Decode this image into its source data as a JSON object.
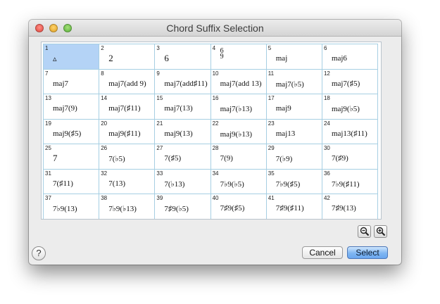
{
  "window": {
    "title": "Chord Suffix Selection"
  },
  "grid": {
    "cells": [
      {
        "n": "1",
        "label": "▵"
      },
      {
        "n": "2",
        "label": "2"
      },
      {
        "n": "3",
        "label": "6"
      },
      {
        "n": "4",
        "label_top": "6",
        "label_bottom": "9"
      },
      {
        "n": "5",
        "label": "maj"
      },
      {
        "n": "6",
        "label": "maj6"
      },
      {
        "n": "7",
        "label": "maj7"
      },
      {
        "n": "8",
        "label": "maj7(add 9)"
      },
      {
        "n": "9",
        "label": "maj7(add♯11)"
      },
      {
        "n": "10",
        "label": "maj7(add 13)"
      },
      {
        "n": "11",
        "label": "maj7(♭5)"
      },
      {
        "n": "12",
        "label": "maj7(♯5)"
      },
      {
        "n": "13",
        "label": "maj7(9)"
      },
      {
        "n": "14",
        "label": "maj7(♯11)"
      },
      {
        "n": "15",
        "label": "maj7(13)"
      },
      {
        "n": "16",
        "label": "maj7(♭13)"
      },
      {
        "n": "17",
        "label": "maj9"
      },
      {
        "n": "18",
        "label": "maj9(♭5)"
      },
      {
        "n": "19",
        "label": "maj9(♯5)"
      },
      {
        "n": "20",
        "label": "maj9(♯11)"
      },
      {
        "n": "21",
        "label": "maj9(13)"
      },
      {
        "n": "22",
        "label": "maj9(♭13)"
      },
      {
        "n": "23",
        "label": "maj13"
      },
      {
        "n": "24",
        "label": "maj13(♯11)"
      },
      {
        "n": "25",
        "label": "7"
      },
      {
        "n": "26",
        "label": "7(♭5)"
      },
      {
        "n": "27",
        "label": "7(♯5)"
      },
      {
        "n": "28",
        "label": "7(9)"
      },
      {
        "n": "29",
        "label": "7(♭9)"
      },
      {
        "n": "30",
        "label": "7(♯9)"
      },
      {
        "n": "31",
        "label": "7(♯11)"
      },
      {
        "n": "32",
        "label": "7(13)"
      },
      {
        "n": "33",
        "label": "7(♭13)"
      },
      {
        "n": "34",
        "label": "7♭9(♭5)"
      },
      {
        "n": "35",
        "label": "7♭9(♯5)"
      },
      {
        "n": "36",
        "label": "7♭9(♯11)"
      },
      {
        "n": "37",
        "label": "7♭9(13)"
      },
      {
        "n": "38",
        "label": "7♭9(♭13)"
      },
      {
        "n": "39",
        "label": "7♯9(♭5)"
      },
      {
        "n": "40",
        "label": "7♯9(♯5)"
      },
      {
        "n": "41",
        "label": "7♯9(♯11)"
      },
      {
        "n": "42",
        "label": "7♯9(13)"
      }
    ],
    "selected_index": 1
  },
  "toolbar": {
    "zoom_out_icon": "zoom-out-magnifier",
    "zoom_in_icon": "zoom-in-magnifier"
  },
  "footer": {
    "help_label": "?",
    "cancel_label": "Cancel",
    "select_label": "Select"
  },
  "colors": {
    "selected_cell": "#b4d3f6",
    "grid_lines": "#a6cfe3",
    "select_button": "#7fb6f2"
  }
}
